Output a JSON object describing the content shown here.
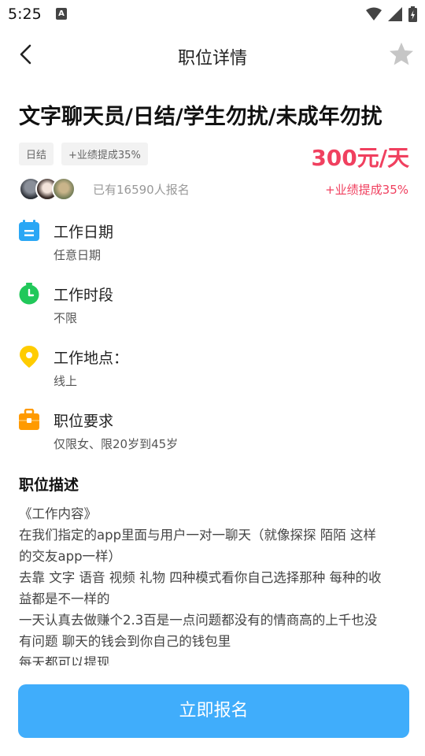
{
  "status_bar": {
    "time": "5:25",
    "notification_badge": "A"
  },
  "nav": {
    "title": "职位详情"
  },
  "job": {
    "title": "文字聊天员/日结/学生勿扰/未成年勿扰",
    "tags": [
      "日结",
      "+业绩提成35%"
    ],
    "salary": "300元/天",
    "signup_count": "已有16590人报名",
    "commission": "+业绩提成35%"
  },
  "info": [
    {
      "icon": "calendar-icon",
      "label": "工作日期",
      "value": "任意日期",
      "color": "#2aa7f5"
    },
    {
      "icon": "clock-icon",
      "label": "工作时段",
      "value": "不限",
      "color": "#21c85a"
    },
    {
      "icon": "location-pin-icon",
      "label": "工作地点：",
      "value": "线上",
      "color": "#ffcc00"
    },
    {
      "icon": "briefcase-icon",
      "label": "职位要求",
      "value": "仅限女、限20岁到45岁",
      "color": "#ff9a00"
    }
  ],
  "description": {
    "title": "职位描述",
    "lines": [
      "《工作内容》",
      "在我们指定的app里面与用户一对一聊天（就像探探 陌陌 这样",
      "的交友app一样）",
      "去靠 文字 语音 视频 礼物 四种模式看你自己选择那种 每种的收",
      "益都是不一样的",
      "一天认真去做赚个2.3百是一点问题都没有的情商高的上千也没",
      "有问题 聊天的钱会到你自己的钱包里",
      "每天都可以提现"
    ]
  },
  "apply_button": "立即报名",
  "colors": {
    "accent": "#40adfb",
    "price": "#f0405f"
  }
}
